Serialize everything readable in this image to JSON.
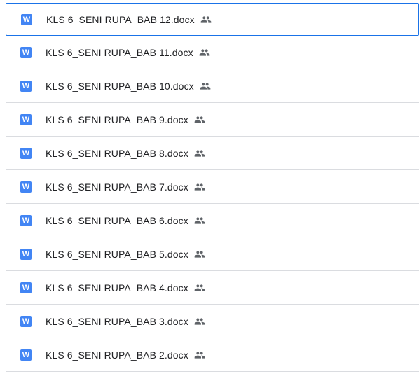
{
  "file_type_icon": {
    "glyph": "W",
    "color": "#4285f4"
  },
  "files": [
    {
      "name": "KLS 6_SENI RUPA_BAB 12.docx",
      "shared_icon": "people-icon",
      "selected": true
    },
    {
      "name": "KLS 6_SENI RUPA_BAB 11.docx",
      "shared_icon": "people-icon"
    },
    {
      "name": "KLS 6_SENI RUPA_BAB 10.docx",
      "shared_icon": "people-icon"
    },
    {
      "name": "KLS 6_SENI RUPA_BAB 9.docx",
      "shared_icon": "people-icon"
    },
    {
      "name": "KLS 6_SENI RUPA_BAB 8.docx",
      "shared_icon": "people-icon"
    },
    {
      "name": "KLS 6_SENI RUPA_BAB 7.docx",
      "shared_icon": "people-icon"
    },
    {
      "name": "KLS 6_SENI RUPA_BAB 6.docx",
      "shared_icon": "people-icon"
    },
    {
      "name": "KLS 6_SENI RUPA_BAB 5.docx",
      "shared_icon": "people-icon"
    },
    {
      "name": "KLS 6_SENI RUPA_BAB 4.docx",
      "shared_icon": "people-icon"
    },
    {
      "name": "KLS 6_SENI RUPA_BAB 3.docx",
      "shared_icon": "people-icon"
    },
    {
      "name": "KLS 6_SENI RUPA_BAB 2.docx",
      "shared_icon": "people-icon"
    }
  ],
  "colors": {
    "selected_border": "#1a73e8",
    "divider": "#dadce0",
    "text": "#202124",
    "icon_gray": "#5f6368"
  }
}
